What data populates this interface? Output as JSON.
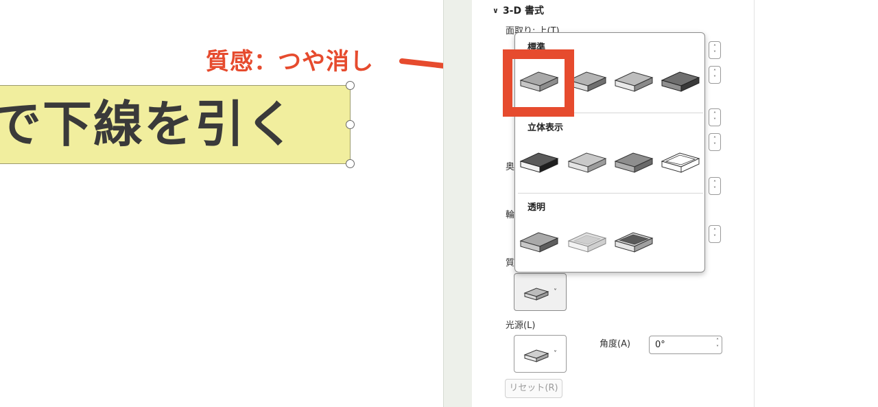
{
  "slide": {
    "text": "で下線を引く"
  },
  "annotation": {
    "label": "質感：つや消し",
    "color": "#e64b2e"
  },
  "pane": {
    "section_title": "3-D 書式",
    "bevel_top_label": "面取り: 上(T)",
    "depth_partial": "奥",
    "contour_partial": "輪",
    "material_partial": "質",
    "lighting_label": "光源(L)",
    "angle_label": "角度(A)",
    "angle_value": "0°",
    "reset_label": "リセット(R)"
  },
  "gallery": {
    "groups": [
      {
        "title": "標準",
        "icons": [
          "matte-material-icon",
          "warm-matte-material-icon",
          "plastic-material-icon",
          "metal-material-icon"
        ]
      },
      {
        "title": "立体表示",
        "icons": [
          "dark-edge-material-icon",
          "soft-edge-material-icon",
          "flat-material-icon",
          "wireframe-material-icon"
        ]
      },
      {
        "title": "透明",
        "icons": [
          "powder-material-icon",
          "clear-material-icon",
          "translucent-powder-material-icon"
        ]
      }
    ]
  }
}
